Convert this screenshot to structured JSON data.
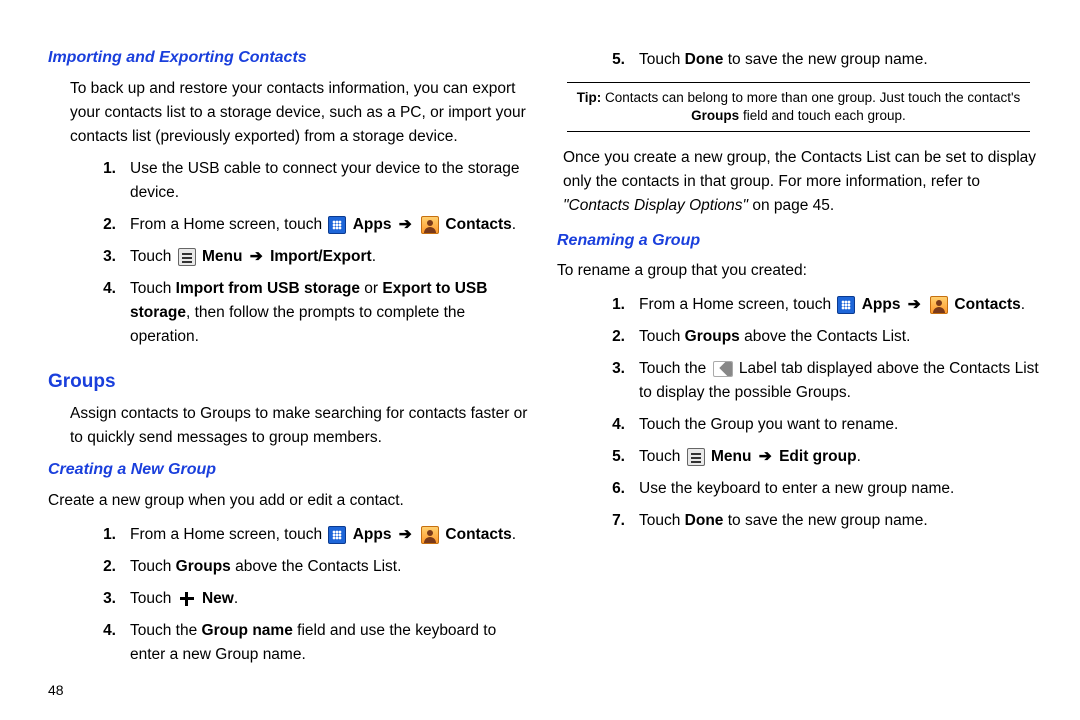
{
  "page_number": "48",
  "left": {
    "sub1_title": "Importing and Exporting Contacts",
    "sub1_lead": "To back up and restore your contacts information, you can export your contacts list to a storage device, such as a PC, or import your contacts list (previously exported) from a storage device.",
    "s1_n1": "1.",
    "s1_t1": "Use the USB cable to connect your device to the storage device.",
    "s1_n2": "2.",
    "s1_t2a": "From a Home screen, touch ",
    "s1_apps": " Apps",
    "s1_contacts": " Contacts",
    "s1_n3": "3.",
    "s1_t3a": "Touch ",
    "s1_t3b": " Menu",
    "s1_t3c": "Import/Export",
    "s1_n4": "4.",
    "s1_t4a": "Touch ",
    "s1_t4b": "Import from USB storage",
    "s1_t4c": " or ",
    "s1_t4d": "Export to USB storage",
    "s1_t4e": ", then follow the prompts to complete the operation.",
    "sect_title": "Groups",
    "sect_lead": "Assign contacts to Groups to make searching for contacts faster or to quickly send messages to group members.",
    "sub2_title": "Creating a New Group",
    "sub2_lead": "Create a new group when you add or edit a contact.",
    "s2_n1": "1.",
    "s2_n2": "2.",
    "s2_t2a": "Touch ",
    "s2_t2b": "Groups",
    "s2_t2c": " above the Contacts List.",
    "s2_n3": "3.",
    "s2_t3a": "Touch ",
    "s2_t3b": " New",
    "s2_n4": "4.",
    "s2_t4a": "Touch the ",
    "s2_t4b": "Group name",
    "s2_t4c": " field and use the keyboard to enter a new Group name."
  },
  "right": {
    "r1_n5": "5.",
    "r1_t5a": "Touch ",
    "r1_t5b": "Done",
    "r1_t5c": " to save the new group name.",
    "tip_label": "Tip:",
    "tip_text": " Contacts can belong to more than one group. Just touch the contact's ",
    "tip_bold": "Groups",
    "tip_after": " field and touch each group.",
    "after_tip_a": "Once you create a new group, the Contacts List can be set to display only the contacts in that group. For more information, refer to ",
    "after_tip_ref": "\"Contacts Display Options\"",
    "after_tip_b": " on page 45.",
    "sub3_title": "Renaming a Group",
    "sub3_lead": "To rename a group that you created:",
    "r3_n1": "1.",
    "r3_fromhome": "From a Home screen, touch ",
    "r3_n2": "2.",
    "r3_t2a": "Touch ",
    "r3_t2b": "Groups",
    "r3_t2c": " above the Contacts List.",
    "r3_n3": "3.",
    "r3_t3a": "Touch the ",
    "r3_t3b": " Label tab displayed above the Contacts List to display the possible Groups.",
    "r3_n4": "4.",
    "r3_t4": "Touch the Group you want to rename.",
    "r3_n5": "5.",
    "r3_t5a": "Touch ",
    "r3_t5b": " Menu",
    "r3_t5c": "Edit group",
    "r3_n6": "6.",
    "r3_t6": "Use the keyboard to enter a new group name.",
    "r3_n7": "7.",
    "r3_t7a": "Touch ",
    "r3_t7b": "Done",
    "r3_t7c": " to save the new group name."
  },
  "arrow": "➔",
  "period": "."
}
